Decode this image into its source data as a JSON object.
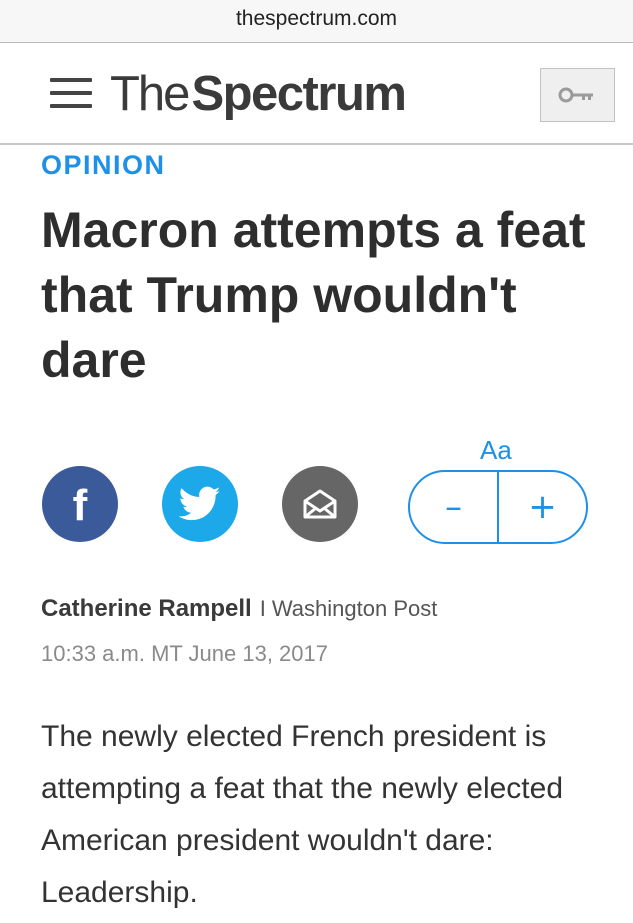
{
  "browser": {
    "url": "thespectrum.com"
  },
  "site": {
    "logo_light": "The",
    "logo_bold": "Spectrum"
  },
  "icons": {
    "menu": "hamburger-menu-icon",
    "key": "key-icon",
    "facebook": "facebook-icon",
    "twitter": "twitter-icon",
    "email": "email-icon"
  },
  "colors": {
    "accent": "#1e90e8",
    "facebook": "#3b5a99",
    "twitter": "#1da8ea",
    "email": "#666666"
  },
  "article": {
    "section": "OPINION",
    "headline": "Macron attempts a feat that Trump wouldn't dare",
    "author": "Catherine Rampell",
    "separator": "I",
    "source": "Washington Post",
    "timestamp": "10:33 a.m. MT June 13, 2017",
    "lede": "The newly elected French president is attempting a feat that the newly elected American president wouldn't dare: Leadership."
  },
  "tools": {
    "text_size_label": "Aa",
    "decrease_label": "–",
    "increase_label": "+"
  }
}
